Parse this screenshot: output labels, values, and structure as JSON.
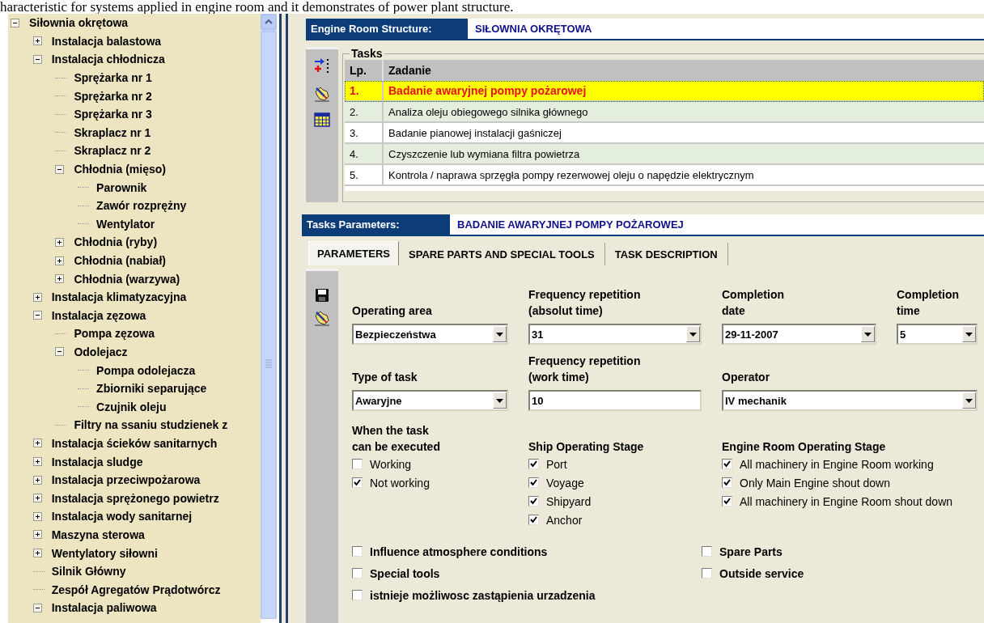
{
  "caption": "haracteristic for systems applied in engine room and it demonstrates of power plant structure.",
  "tree": [
    {
      "label": "Siłownia okrętowa",
      "kind": "branch",
      "expanded": true,
      "children": [
        {
          "label": "Instalacja balastowa",
          "kind": "branch",
          "expanded": false
        },
        {
          "label": "Instalacja chłodnicza",
          "kind": "branch",
          "expanded": true,
          "children": [
            {
              "label": "Sprężarka nr 1",
              "kind": "leaf"
            },
            {
              "label": "Sprężarka nr 2",
              "kind": "leaf"
            },
            {
              "label": "Sprężarka nr 3",
              "kind": "leaf"
            },
            {
              "label": "Skraplacz nr 1",
              "kind": "leaf"
            },
            {
              "label": "Skraplacz nr 2",
              "kind": "leaf"
            },
            {
              "label": "Chłodnia (mięso)",
              "kind": "branch",
              "expanded": true,
              "children": [
                {
                  "label": "Parownik",
                  "kind": "leaf"
                },
                {
                  "label": "Zawór rozprężny",
                  "kind": "leaf"
                },
                {
                  "label": "Wentylator",
                  "kind": "leaf"
                }
              ]
            },
            {
              "label": "Chłodnia (ryby)",
              "kind": "branch",
              "expanded": false
            },
            {
              "label": "Chłodnia (nabiał)",
              "kind": "branch",
              "expanded": false
            },
            {
              "label": "Chłodnia (warzywa)",
              "kind": "branch",
              "expanded": false
            }
          ]
        },
        {
          "label": "Instalacja klimatyzacyjna",
          "kind": "branch",
          "expanded": false
        },
        {
          "label": "Instalacja zęzowa",
          "kind": "branch",
          "expanded": true,
          "children": [
            {
              "label": "Pompa zęzowa",
              "kind": "leaf"
            },
            {
              "label": "Odolejacz",
              "kind": "branch",
              "expanded": true,
              "children": [
                {
                  "label": "Pompa odolejacza",
                  "kind": "leaf"
                },
                {
                  "label": "Zbiorniki separujące",
                  "kind": "leaf"
                },
                {
                  "label": "Czujnik oleju",
                  "kind": "leaf"
                }
              ]
            },
            {
              "label": "Filtry na ssaniu studzienek z",
              "kind": "leaf"
            }
          ]
        },
        {
          "label": "Instalacja ścieków sanitarnych",
          "kind": "branch",
          "expanded": false
        },
        {
          "label": "Instalacja sludge",
          "kind": "branch",
          "expanded": false
        },
        {
          "label": "Instalacja przeciwpożarowa",
          "kind": "branch",
          "expanded": false
        },
        {
          "label": "Instalacja sprężonego powietrz",
          "kind": "branch",
          "expanded": false
        },
        {
          "label": "Instalacja wody sanitarnej",
          "kind": "branch",
          "expanded": false
        },
        {
          "label": "Maszyna sterowa",
          "kind": "branch",
          "expanded": false
        },
        {
          "label": "Wentylatory siłowni",
          "kind": "branch",
          "expanded": false
        },
        {
          "label": "Silnik Główny",
          "kind": "leaf"
        },
        {
          "label": "Zespół Agregatów Prądotwórcz",
          "kind": "leaf"
        },
        {
          "label": "Instalacja paliwowa",
          "kind": "branch",
          "expanded": true
        }
      ]
    }
  ],
  "structure": {
    "label": "Engine Room Structure:",
    "value": "SIŁOWNIA OKRĘTOWA"
  },
  "tasks": {
    "title": "Tasks",
    "columns": [
      "Lp.",
      "Zadanie"
    ],
    "rows": [
      {
        "cells": [
          "1.",
          "Badanie awaryjnej pompy pożarowej"
        ],
        "selected": true
      },
      {
        "cells": [
          "2.",
          "Analiza oleju obiegowego silnika głównego"
        ],
        "selected": false
      },
      {
        "cells": [
          "3.",
          "Badanie pianowej instalacji gaśniczej"
        ],
        "selected": false
      },
      {
        "cells": [
          "4.",
          "Czyszczenie lub wymiana filtra powietrza"
        ],
        "selected": false
      },
      {
        "cells": [
          "5.",
          "Kontrola / naprawa sprzęgła pompy rezerwowej oleju o napędzie elektrycznym"
        ],
        "selected": false
      }
    ]
  },
  "task_parameters": {
    "label": "Tasks Parameters:",
    "value": "BADANIE AWARYJNEJ POMPY POŻAROWEJ"
  },
  "tabs": [
    {
      "label": "PARAMETERS",
      "selected": true
    },
    {
      "label": "SPARE PARTS AND SPECIAL TOOLS",
      "selected": false
    },
    {
      "label": "TASK DESCRIPTION",
      "selected": false
    }
  ],
  "field_rows": [
    [
      {
        "label": "Operating area",
        "kind": "combo",
        "value": "Bezpieczeństwa"
      },
      {
        "label": "Frequency repetition\n(absolut time)",
        "kind": "combo",
        "value": "31"
      },
      {
        "label": "Completion\ndate",
        "kind": "combo",
        "value": "29-11-2007"
      },
      {
        "label": "Completion\ntime",
        "kind": "combo",
        "value": "5"
      }
    ],
    [
      {
        "label": "Type of task",
        "kind": "combo",
        "value": "Awaryjne"
      },
      {
        "label": "Frequency repetition\n(work time)",
        "kind": "text",
        "value": "10"
      },
      {
        "label": "Operator",
        "kind": "combo",
        "value": "IV mechanik"
      }
    ]
  ],
  "check_groups": [
    {
      "title": "When the task\ncan be executed",
      "items": [
        {
          "label": "Working",
          "checked": false
        },
        {
          "label": "Not working",
          "checked": true
        }
      ]
    },
    {
      "title": "Ship Operating Stage",
      "items": [
        {
          "label": "Port",
          "checked": true
        },
        {
          "label": "Voyage",
          "checked": true
        },
        {
          "label": "Shipyard",
          "checked": true
        },
        {
          "label": "Anchor",
          "checked": true
        }
      ]
    },
    {
      "title": "Engine Room Operating Stage",
      "items": [
        {
          "label": "All machinery in Engine Room working",
          "checked": true
        },
        {
          "label": "Only Main Engine shout down",
          "checked": true
        },
        {
          "label": "All machinery in Engine Room shout down",
          "checked": true
        }
      ]
    }
  ],
  "options_left": [
    {
      "label": "Influence atmosphere conditions",
      "checked": false
    },
    {
      "label": "Special tools",
      "checked": false
    },
    {
      "label": "istnieje możliwosc zastąpienia urzadzenia",
      "checked": false
    }
  ],
  "options_right": [
    {
      "label": "Spare Parts",
      "checked": false
    },
    {
      "label": "Outside service",
      "checked": false
    }
  ]
}
